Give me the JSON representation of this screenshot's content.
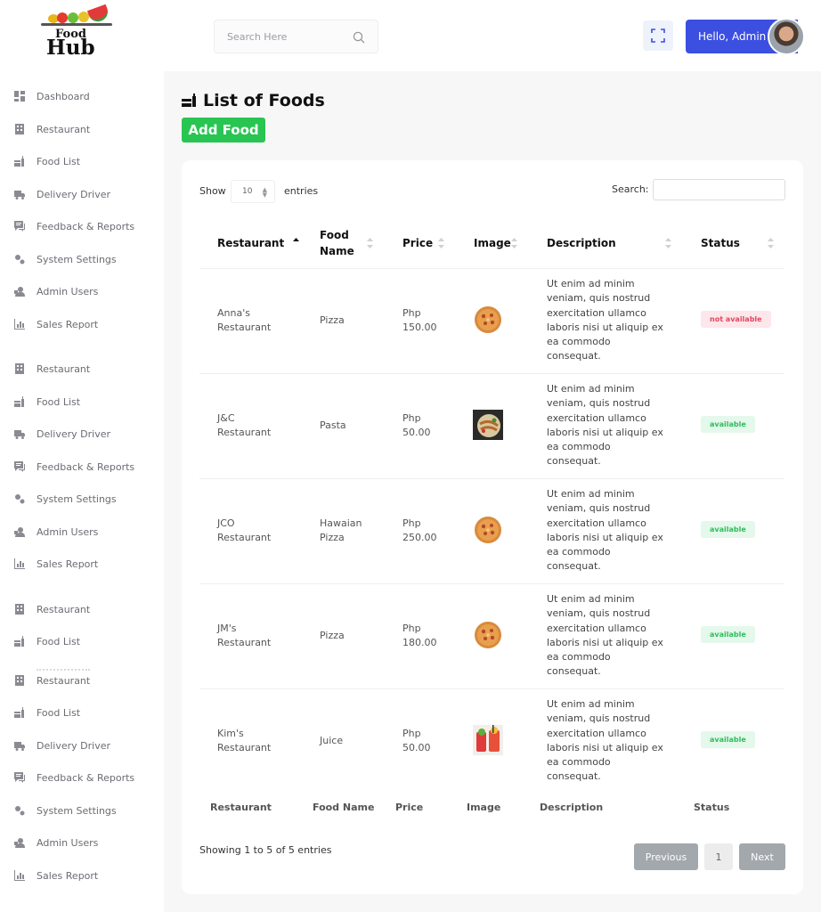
{
  "app": {
    "logo_line1": "Food",
    "logo_line2": "Hub"
  },
  "sidebar": {
    "items": [
      {
        "label": "Dashboard",
        "icon": "dashboard-icon"
      },
      {
        "label": "Restaurant",
        "icon": "building-icon"
      },
      {
        "label": "Food List",
        "icon": "food-icon"
      },
      {
        "label": "Delivery Driver",
        "icon": "truck-icon"
      },
      {
        "label": "Feedback & Reports",
        "icon": "feedback-icon"
      },
      {
        "label": "System Settings",
        "icon": "gears-icon"
      },
      {
        "label": "Admin Users",
        "icon": "admin-user-icon"
      },
      {
        "label": "Sales Report",
        "icon": "chart-icon"
      },
      {
        "label": "Restaurant",
        "icon": "building-icon"
      },
      {
        "label": "Food List",
        "icon": "food-icon"
      },
      {
        "label": "Delivery Driver",
        "icon": "truck-icon"
      },
      {
        "label": "Feedback & Reports",
        "icon": "feedback-icon"
      },
      {
        "label": "System Settings",
        "icon": "gears-icon"
      },
      {
        "label": "Admin Users",
        "icon": "admin-user-icon"
      },
      {
        "label": "Sales Report",
        "icon": "chart-icon"
      },
      {
        "label": "Restaurant",
        "icon": "building-icon"
      },
      {
        "label": "Food List",
        "icon": "food-icon"
      },
      {
        "label": "Restaurant",
        "icon": "building-icon"
      },
      {
        "label": "Food List",
        "icon": "food-icon"
      },
      {
        "label": "Delivery Driver",
        "icon": "truck-icon"
      },
      {
        "label": "Feedback & Reports",
        "icon": "feedback-icon"
      },
      {
        "label": "System Settings",
        "icon": "gears-icon"
      },
      {
        "label": "Admin Users",
        "icon": "admin-user-icon"
      },
      {
        "label": "Sales Report",
        "icon": "chart-icon"
      }
    ]
  },
  "header": {
    "search_placeholder": "Search Here",
    "greeting": "Hello, Admin"
  },
  "page": {
    "title": "List of Foods",
    "add_button": "Add Food"
  },
  "table_controls": {
    "show": "Show",
    "entries_value": "10",
    "entries": "entries",
    "search_label": "Search:"
  },
  "table": {
    "headers": {
      "restaurant": "Restaurant",
      "food_name_1": "Food",
      "food_name_2": "Name",
      "price": "Price",
      "image": "Image",
      "description": "Description",
      "status": "Status"
    },
    "footer": [
      "Restaurant",
      "Food Name",
      "Price",
      "Image",
      "Description",
      "Status"
    ],
    "rows": [
      {
        "restaurant_1": "Anna's",
        "restaurant_2": "Restaurant",
        "food_1": "Pizza",
        "food_2": "",
        "price_1": "Php",
        "price_2": "150.00",
        "image": "pizza",
        "status": "not available"
      },
      {
        "restaurant_1": "J&C",
        "restaurant_2": "Restaurant",
        "food_1": "Pasta",
        "food_2": "",
        "price_1": "Php",
        "price_2": "50.00",
        "image": "pasta",
        "status": "available"
      },
      {
        "restaurant_1": "JCO",
        "restaurant_2": "Restaurant",
        "food_1": "Hawaian",
        "food_2": "Pizza",
        "price_1": "Php",
        "price_2": "250.00",
        "image": "pizza",
        "status": "available"
      },
      {
        "restaurant_1": "JM's",
        "restaurant_2": "Restaurant",
        "food_1": "Pizza",
        "food_2": "",
        "price_1": "Php",
        "price_2": "180.00",
        "image": "pizza",
        "status": "available"
      },
      {
        "restaurant_1": "Kim's",
        "restaurant_2": "Restaurant",
        "food_1": "Juice",
        "food_2": "",
        "price_1": "Php",
        "price_2": "50.00",
        "image": "juice",
        "status": "available"
      }
    ],
    "description_lines": [
      "Ut enim ad minim",
      "veniam, quis nostrud",
      "exercitation ullamco",
      "laboris nisi ut aliquip ex",
      "ea commodo",
      "consequat."
    ]
  },
  "pagination": {
    "info": "Showing 1 to 5 of 5 entries",
    "previous": "Previous",
    "page": "1",
    "next": "Next"
  },
  "colors": {
    "primary": "#3b4fe0",
    "success": "#28c552",
    "danger": "#e0475e"
  }
}
